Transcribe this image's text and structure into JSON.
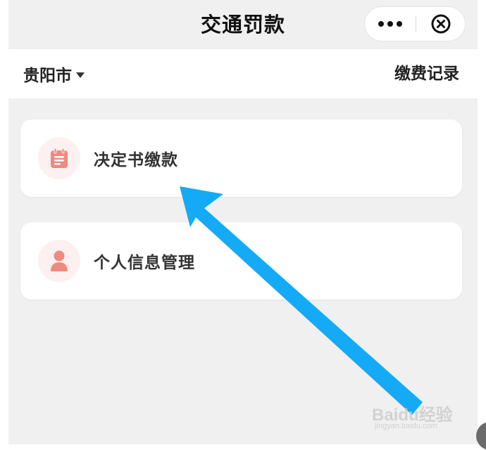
{
  "header": {
    "title": "交通罚款",
    "more_icon": "more-dots-icon",
    "close_icon": "circle-close-icon"
  },
  "city_bar": {
    "city": "贵阳市",
    "payment_records": "缴费记录"
  },
  "menu": {
    "items": [
      {
        "label": "决定书缴款",
        "icon": "notepad-icon",
        "icon_color": "#ee8a7f"
      },
      {
        "label": "个人信息管理",
        "icon": "person-icon",
        "icon_color": "#ee8a7f"
      }
    ]
  },
  "annotation": {
    "arrow_color": "#15aaf5"
  },
  "watermark": {
    "brand": "Baidu经验",
    "url": "jingyan.baidu.com"
  },
  "colors": {
    "background": "#f0f0f0",
    "card": "#ffffff",
    "icon_bg": "#fdf0f0",
    "accent": "#ee8a7f"
  }
}
